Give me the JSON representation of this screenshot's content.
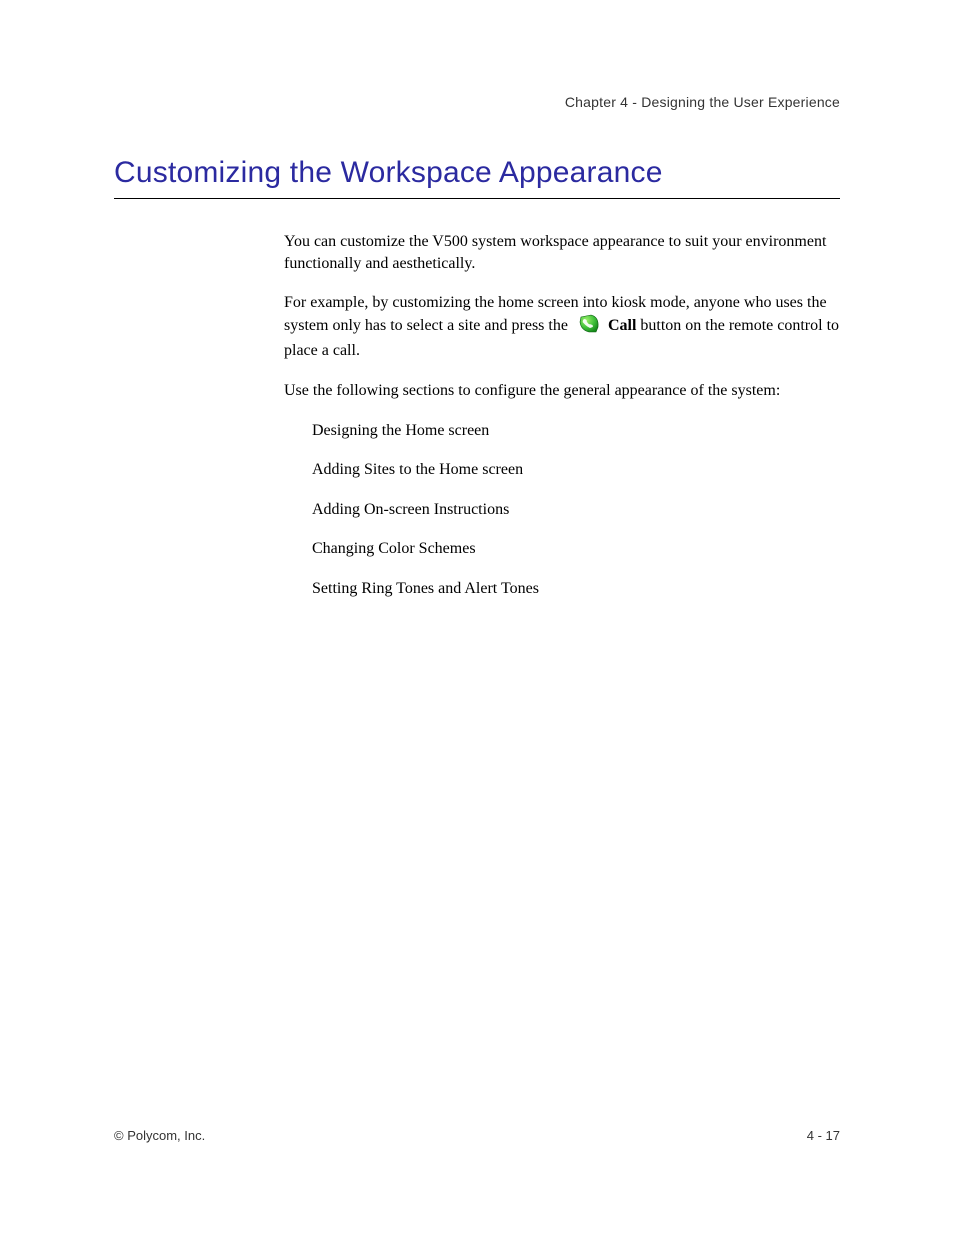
{
  "header": {
    "chapter_line": "Chapter 4 - Designing the User Experience"
  },
  "section": {
    "title": "Customizing the Workspace Appearance"
  },
  "body": {
    "p1": "You can customize the V500 system workspace appearance to suit your environment functionally and aesthetically.",
    "p2a": "For example, by customizing the home screen into kiosk mode, anyone who uses the system only has to select a site and press the",
    "call_label": "Call",
    "p2b": "button on the remote control to place a call.",
    "p3": "Use the following sections to configure the general appearance of the system:",
    "list": [
      "Designing the Home screen",
      "Adding Sites to the Home screen",
      "Adding On-screen Instructions",
      "Changing Color Schemes",
      "Setting Ring Tones and Alert Tones"
    ]
  },
  "footer": {
    "copyright": "© Polycom, Inc.",
    "page_number": "4 - 17"
  }
}
